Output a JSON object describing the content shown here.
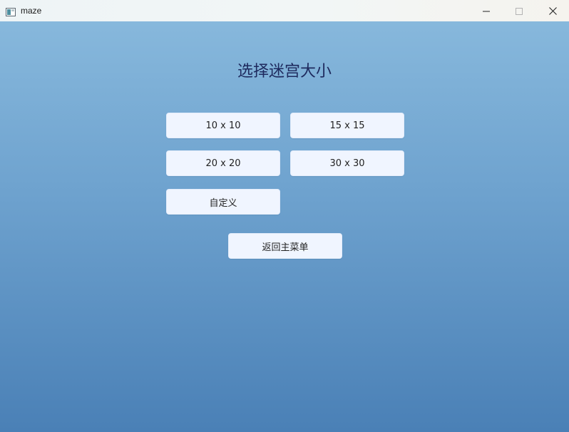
{
  "window": {
    "title": "maze",
    "icon": "app-window-icon",
    "controls": {
      "minimize": "minimize-icon",
      "maximize": "maximize-icon",
      "close": "close-icon"
    }
  },
  "page": {
    "title": "选择迷宫大小",
    "size_options": [
      {
        "label": "10 x 10"
      },
      {
        "label": "15 x 15"
      },
      {
        "label": "20 x 20"
      },
      {
        "label": "30 x 30"
      }
    ],
    "custom_label": "自定义",
    "back_label": "返回主菜单"
  },
  "colors": {
    "title_text": "#1e2a5e",
    "button_bg": "#f0f5ff",
    "gradient_top": "#87b8dc",
    "gradient_bottom": "#4a80b6"
  }
}
